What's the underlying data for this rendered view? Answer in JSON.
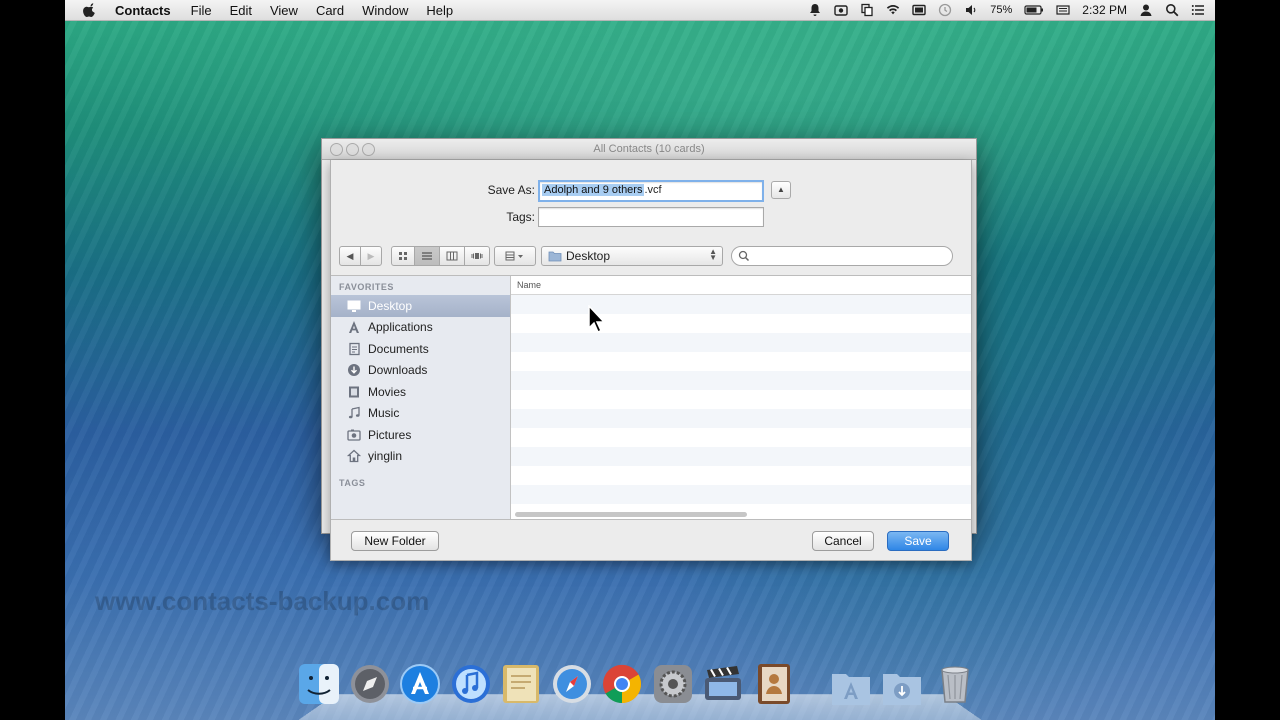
{
  "menubar": {
    "app_name": "Contacts",
    "menus": [
      "File",
      "Edit",
      "View",
      "Card",
      "Window",
      "Help"
    ],
    "battery": "75%",
    "clock": "2:32 PM"
  },
  "window": {
    "title": "All Contacts (10 cards)"
  },
  "save_panel": {
    "save_as_label": "Save As:",
    "filename_selected": "Adolph and 9 others",
    "filename_ext": ".vcf",
    "tags_label": "Tags:",
    "tags_value": "",
    "location": "Desktop",
    "search_placeholder": ""
  },
  "sidebar": {
    "favorites_heading": "FAVORITES",
    "items": [
      {
        "label": "Desktop",
        "icon": "desktop-icon",
        "selected": true
      },
      {
        "label": "Applications",
        "icon": "applications-icon"
      },
      {
        "label": "Documents",
        "icon": "documents-icon"
      },
      {
        "label": "Downloads",
        "icon": "downloads-icon"
      },
      {
        "label": "Movies",
        "icon": "movies-icon"
      },
      {
        "label": "Music",
        "icon": "music-icon"
      },
      {
        "label": "Pictures",
        "icon": "pictures-icon"
      },
      {
        "label": "yinglin",
        "icon": "home-icon"
      }
    ],
    "tags_heading": "TAGS"
  },
  "file_list": {
    "column_name": "Name"
  },
  "buttons": {
    "new_folder": "New Folder",
    "cancel": "Cancel",
    "save": "Save"
  },
  "watermark": "www.contacts-backup.com",
  "colors": {
    "default_button": "#2f86e6",
    "selection": "#a8cdf2",
    "sidebar_bg": "#e7eaf0"
  },
  "dock_icons": [
    "finder-icon",
    "launchpad-icon",
    "app-store-icon",
    "itunes-icon",
    "notes-icon",
    "safari-icon",
    "chrome-icon",
    "system-preferences-icon",
    "imovie-icon",
    "contacts-icon",
    "applications-folder-icon",
    "downloads-folder-icon",
    "trash-icon"
  ]
}
